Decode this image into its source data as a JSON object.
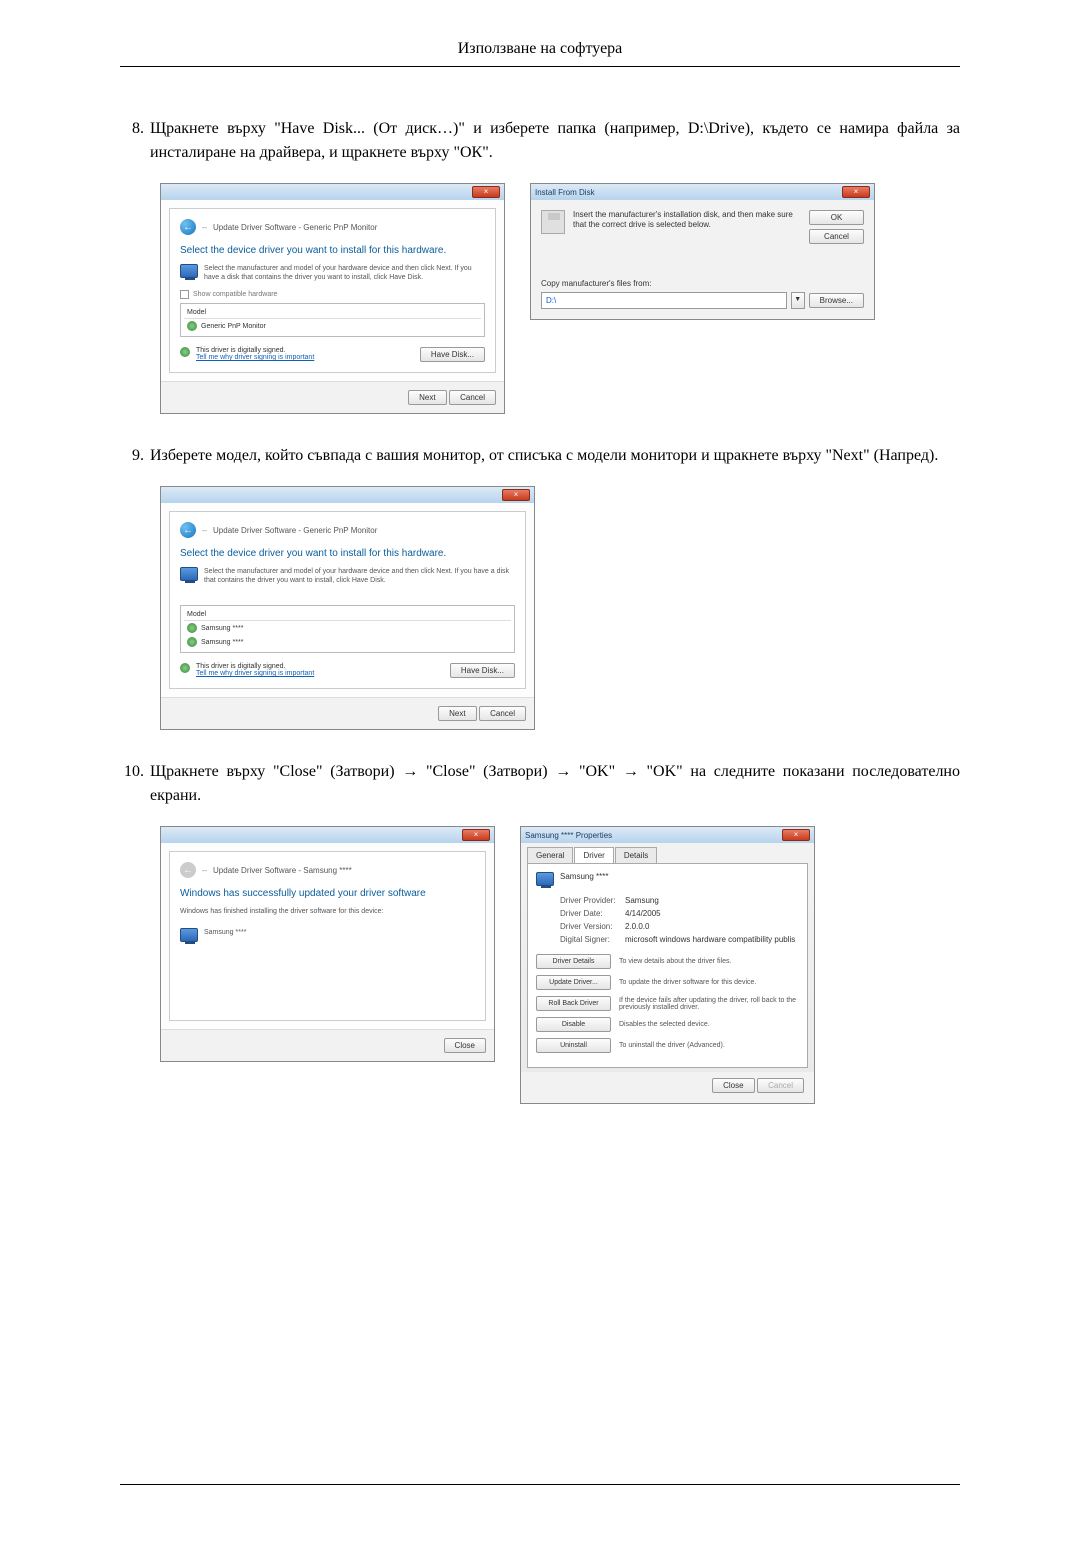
{
  "header": {
    "title": "Използване на софтуера"
  },
  "steps": {
    "s8": {
      "num": "8.",
      "text": "Щракнете върху \"Have Disk... (От диск…)\" и изберете папка (например, D:\\Drive), където се намира файла за инсталиране на драйвера, и щракнете върху \"ОК\"."
    },
    "s9": {
      "num": "9.",
      "text": "Изберете модел, който съвпада с вашия монитор, от списъка с модели монитори и щракнете върху \"Next\" (Напред)."
    },
    "s10": {
      "num": "10.",
      "text": "Щракнете върху \"Close\" (Затвори) → \"Close\" (Затвори) → \"OK\" → \"OK\" на следните показани последователно екрани."
    }
  },
  "dlg1": {
    "breadcrumb": "Update Driver Software - Generic PnP Monitor",
    "heading": "Select the device driver you want to install for this hardware.",
    "body": "Select the manufacturer and model of your hardware device and then click Next. If you have a disk that contains the driver you want to install, click Have Disk.",
    "chk_label": "Show compatible hardware",
    "list_header": "Model",
    "list_item": "Generic PnP Monitor",
    "signed": "This driver is digitally signed.",
    "tell_link": "Tell me why driver signing is important",
    "have_disk": "Have Disk...",
    "next": "Next",
    "cancel": "Cancel"
  },
  "install_disk": {
    "title": "Install From Disk",
    "text": "Insert the manufacturer's installation disk, and then make sure that the correct drive is selected below.",
    "ok": "OK",
    "cancel": "Cancel",
    "copy_label": "Copy manufacturer's files from:",
    "path": "D:\\",
    "browse": "Browse..."
  },
  "dlg2": {
    "breadcrumb": "Update Driver Software - Generic PnP Monitor",
    "heading": "Select the device driver you want to install for this hardware.",
    "body": "Select the manufacturer and model of your hardware device and then click Next. If you have a disk that contains the driver you want to install, click Have Disk.",
    "list_header": "Model",
    "item1": "Samsung ****",
    "item2": "Samsung ****",
    "signed": "This driver is digitally signed.",
    "tell_link": "Tell me why driver signing is important",
    "have_disk": "Have Disk...",
    "next": "Next",
    "cancel": "Cancel"
  },
  "dlg3": {
    "breadcrumb": "Update Driver Software - Samsung ****",
    "heading": "Windows has successfully updated your driver software",
    "body": "Windows has finished installing the driver software for this device:",
    "item": "Samsung ****",
    "close": "Close"
  },
  "props": {
    "title": "Samsung **** Properties",
    "tab_general": "General",
    "tab_driver": "Driver",
    "tab_details": "Details",
    "device": "Samsung ****",
    "provider_l": "Driver Provider:",
    "provider_v": "Samsung",
    "date_l": "Driver Date:",
    "date_v": "4/14/2005",
    "version_l": "Driver Version:",
    "version_v": "2.0.0.0",
    "signer_l": "Digital Signer:",
    "signer_v": "microsoft windows hardware compatibility publis",
    "btn_details": "Driver Details",
    "btn_details_d": "To view details about the driver files.",
    "btn_update": "Update Driver...",
    "btn_update_d": "To update the driver software for this device.",
    "btn_rollback": "Roll Back Driver",
    "btn_rollback_d": "If the device fails after updating the driver, roll back to the previously installed driver.",
    "btn_disable": "Disable",
    "btn_disable_d": "Disables the selected device.",
    "btn_uninstall": "Uninstall",
    "btn_uninstall_d": "To uninstall the driver (Advanced).",
    "close": "Close",
    "cancel": "Cancel"
  }
}
